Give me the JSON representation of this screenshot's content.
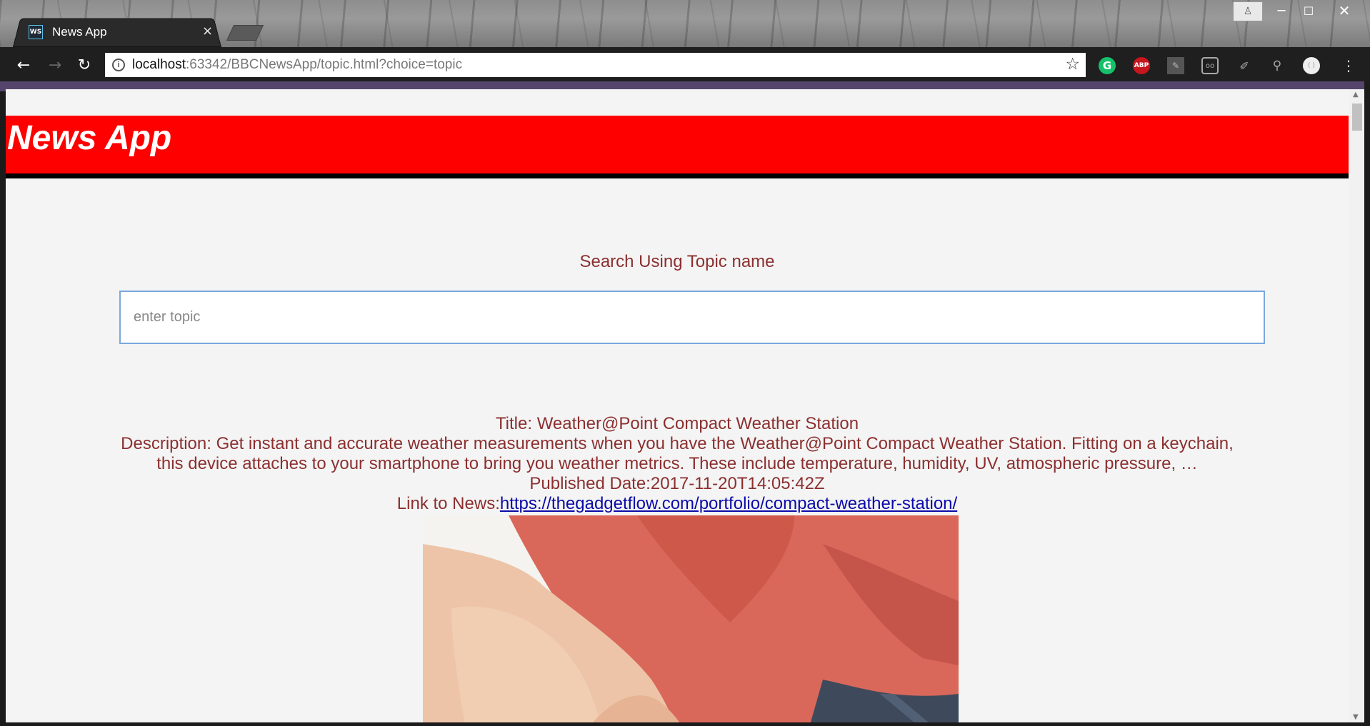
{
  "browser": {
    "tab_title": "News App",
    "tab_favicon_text": "WS",
    "tab_close": "×",
    "url_host": "localhost",
    "url_rest": ":63342/BBCNewsApp/topic.html?choice=topic",
    "extensions": [
      "grammarly-icon",
      "adblock-plus-icon",
      "pdf-icon",
      "screen-recorder-icon",
      "pen-icon",
      "search-icon",
      "profile-circle-icon",
      "menu-icon"
    ],
    "ext_labels": {
      "grammarly": "G",
      "abp": "ABP"
    }
  },
  "header": {
    "title": "News App",
    "background": "#ff0000"
  },
  "search": {
    "label": "Search Using Topic name",
    "placeholder": "enter topic",
    "value": ""
  },
  "article": {
    "title_prefix": "Title: ",
    "title": "Weather@Point Compact Weather Station",
    "description_prefix": "Description: ",
    "description": "Get instant and accurate weather measurements when you have the Weather@Point Compact Weather Station. Fitting on a keychain, this device attaches to your smartphone to bring you weather metrics. These include temperature, humidity, UV, atmospheric pressure, …",
    "published_prefix": "Published Date:",
    "published": "2017-11-20T14:05:42Z",
    "link_prefix": "Link to News:",
    "link": "https://thegadgetflow.com/portfolio/compact-weather-station/",
    "image_subject": "hand pulling red shirt over jeans"
  },
  "colors": {
    "text": "#8b2f2f",
    "link": "#0a0aa8",
    "page_bg": "#f4f4f4",
    "input_border": "#7aa7dc"
  }
}
